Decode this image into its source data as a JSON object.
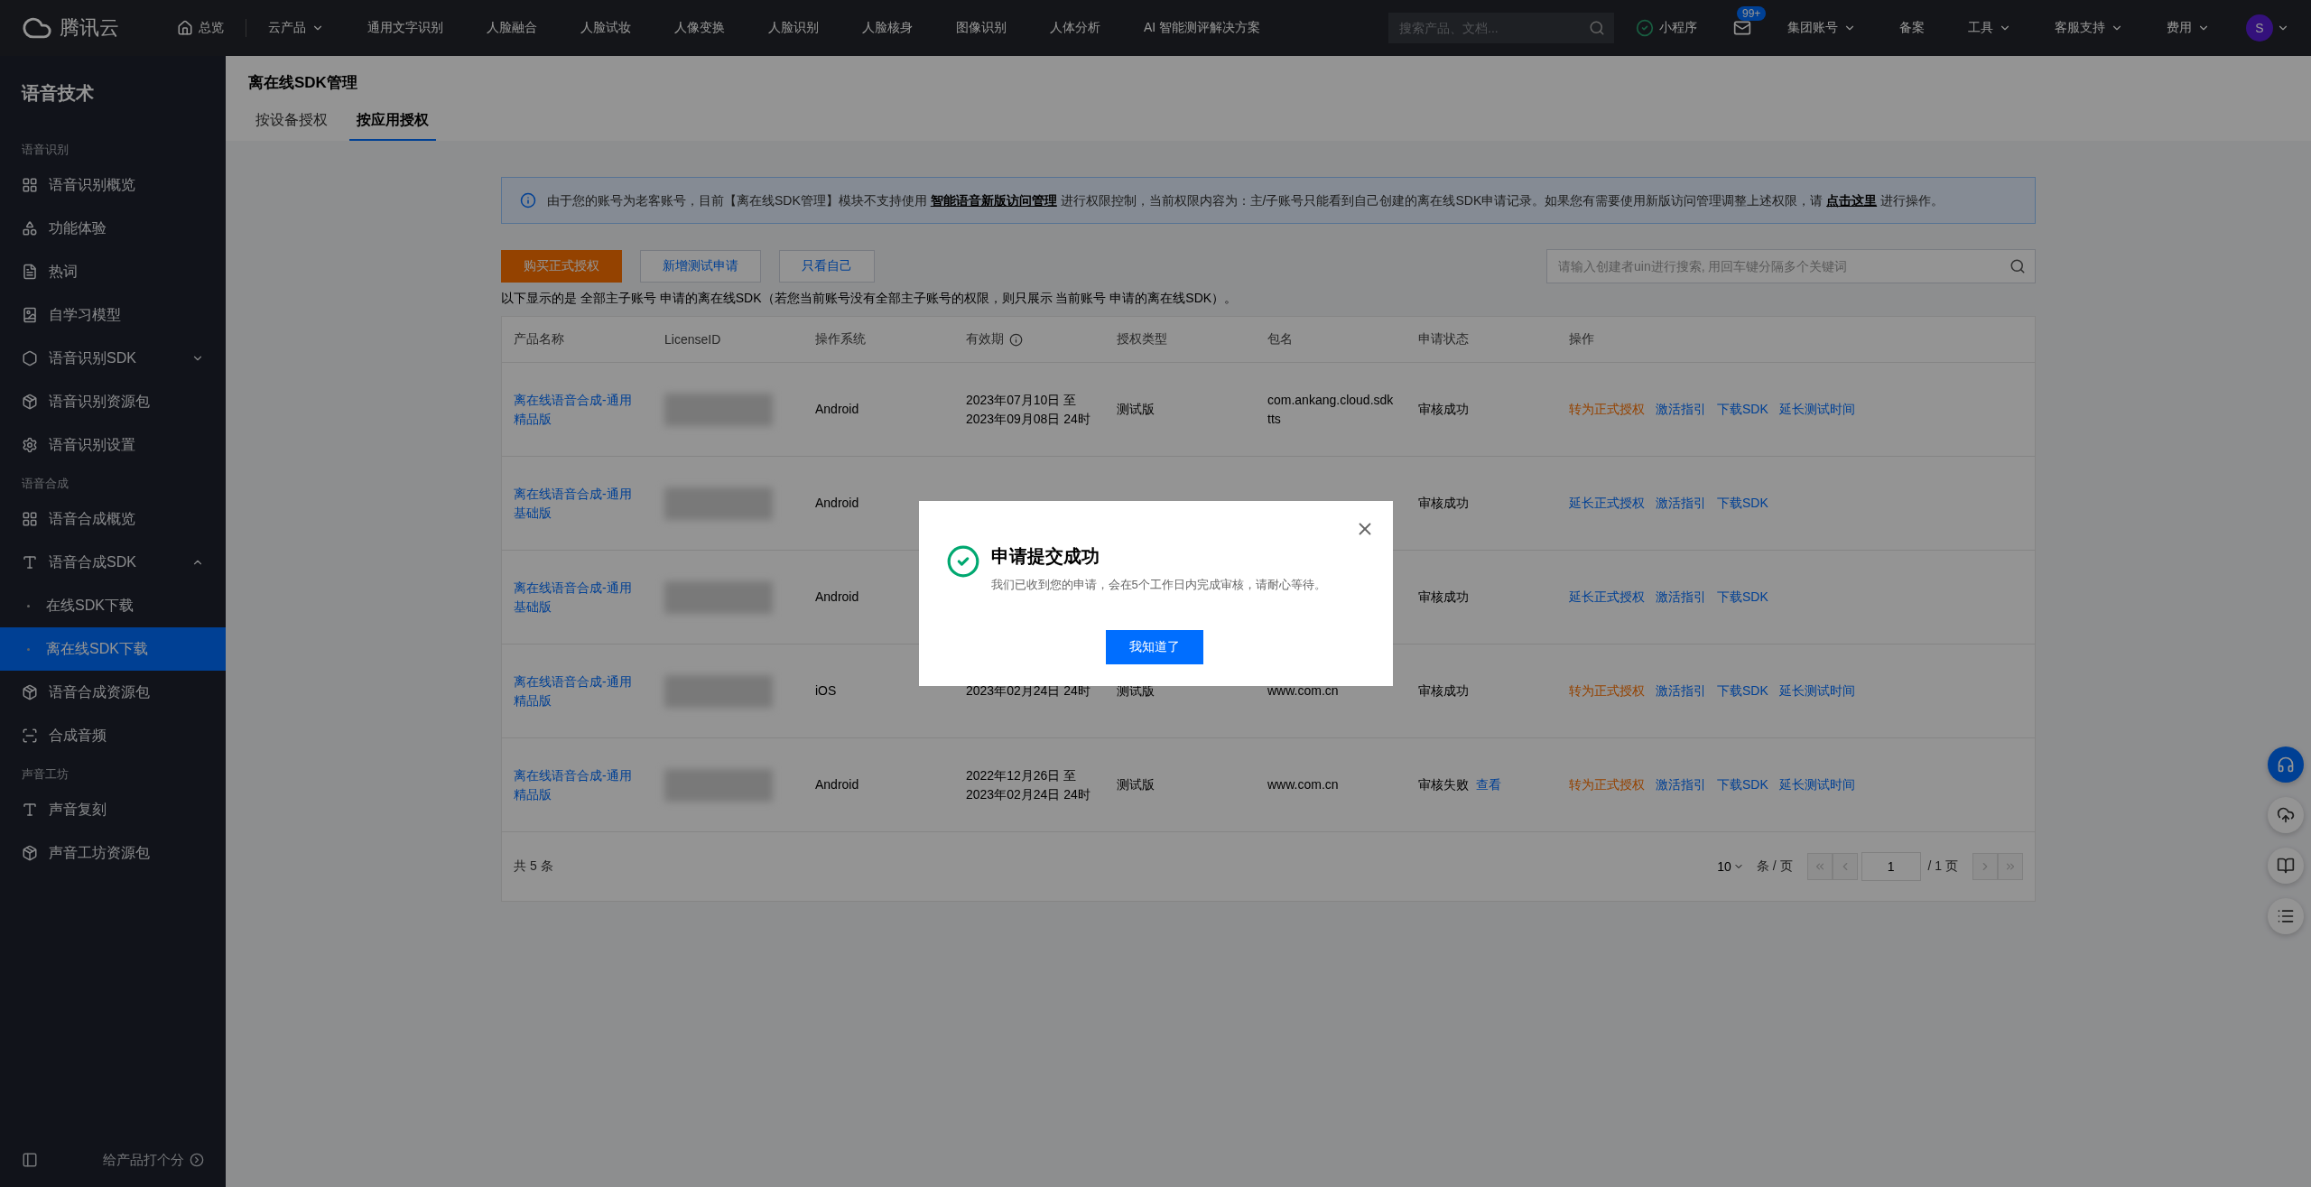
{
  "topbar": {
    "logo": "腾讯云",
    "home": "总览",
    "products": "云产品",
    "nav": [
      "通用文字识别",
      "人脸融合",
      "人脸试妆",
      "人像变换",
      "人脸识别",
      "人脸核身",
      "图像识别",
      "人体分析",
      "AI 智能测评解决方案"
    ],
    "search": {
      "placeholder": "搜索产品、文档..."
    },
    "miniapp": "小程序",
    "mail_badge": "99+",
    "menus": [
      {
        "label": "集团账号",
        "caret": true
      },
      {
        "label": "备案",
        "caret": false
      },
      {
        "label": "工具",
        "caret": true
      },
      {
        "label": "客服支持",
        "caret": true
      },
      {
        "label": "费用",
        "caret": true
      }
    ],
    "avatar": "S"
  },
  "sidebar": {
    "title": "语音技术",
    "groups": [
      {
        "label": "语音识别",
        "items": [
          {
            "label": "语音识别概览",
            "selected": false
          },
          {
            "label": "功能体验",
            "selected": false
          },
          {
            "label": "热词",
            "selected": false
          },
          {
            "label": "自学习模型",
            "selected": false
          },
          {
            "label": "语音识别SDK",
            "selected": false,
            "expanded": false
          },
          {
            "label": "语音识别资源包",
            "selected": false
          },
          {
            "label": "语音识别设置",
            "selected": false
          }
        ]
      },
      {
        "label": "语音合成",
        "items": [
          {
            "label": "语音合成概览",
            "selected": false
          },
          {
            "label": "语音合成SDK",
            "selected": false,
            "expanded": true,
            "children": [
              {
                "label": "在线SDK下载",
                "selected": false
              },
              {
                "label": "离在线SDK下载",
                "selected": true
              }
            ]
          },
          {
            "label": "语音合成资源包",
            "selected": false
          },
          {
            "label": "合成音频",
            "selected": false
          }
        ]
      },
      {
        "label": "声音工坊",
        "items": [
          {
            "label": "声音复刻",
            "selected": false
          },
          {
            "label": "声音工坊资源包",
            "selected": false
          }
        ]
      }
    ],
    "footer": "给产品打个分"
  },
  "page": {
    "title": "离在线SDK管理",
    "tabs": [
      {
        "label": "按设备授权",
        "selected": false
      },
      {
        "label": "按应用授权",
        "selected": true
      }
    ],
    "banner": [
      {
        "kind": "text",
        "text": "由于您的账号为老客账号，目前【离在线SDK管理】模块不支持使用 "
      },
      {
        "kind": "link",
        "text": "智能语音新版访问管理"
      },
      {
        "kind": "text",
        "text": " 进行权限控制，当前权限内容为：主/子账号只能看到自己创建的离在线SDK申请记录。如果您有需要使用新版访问管理调整上述权限，请 "
      },
      {
        "kind": "link",
        "text": "点击这里"
      },
      {
        "kind": "text",
        "text": " 进行操作。"
      }
    ],
    "buttons": [
      {
        "label": "购买正式授权",
        "kind": "primary"
      },
      {
        "label": "新增测试申请",
        "kind": "default"
      },
      {
        "label": "只看自己",
        "kind": "default"
      }
    ],
    "search": {
      "placeholder": "请输入创建者uin进行搜索, 用回车键分隔多个关键词"
    },
    "note": "以下显示的是 全部主子账号 申请的离在线SDK（若您当前账号没有全部主子账号的权限，则只展示 当前账号 申请的离在线SDK）。",
    "table": {
      "columns": [
        {
          "label": "产品名称",
          "info": false
        },
        {
          "label": "LicenseID",
          "info": false
        },
        {
          "label": "操作系统",
          "info": false
        },
        {
          "label": "有效期",
          "info": true
        },
        {
          "label": "授权类型",
          "info": false
        },
        {
          "label": "包名",
          "info": false
        },
        {
          "label": "申请状态",
          "info": false
        },
        {
          "label": "操作",
          "info": false
        }
      ],
      "rows": [
        {
          "product": "离在线语音合成-通用精品版",
          "license_redacted": true,
          "os": "Android",
          "validity": "2023年07月10日 至 2023年09月08日 24时",
          "type": "测试版",
          "package": "com.ankang.cloud.sdktts",
          "status": "审核成功",
          "actions": [
            {
              "label": "转为正式授权",
              "kind": "warn"
            },
            {
              "label": "激活指引",
              "kind": "link"
            },
            {
              "label": "下载SDK",
              "kind": "link"
            },
            {
              "label": "延长测试时间",
              "kind": "link"
            }
          ]
        },
        {
          "product": "离在线语音合成-通用基础版",
          "license_redacted": true,
          "os": "Android",
          "status": "审核成功",
          "actions": [
            {
              "label": "延长正式授权",
              "kind": "link"
            },
            {
              "label": "激活指引",
              "kind": "link"
            },
            {
              "label": "下载SDK",
              "kind": "link"
            }
          ]
        },
        {
          "product": "离在线语音合成-通用基础版",
          "license_redacted": true,
          "os": "Android",
          "status": "审核成功",
          "actions": [
            {
              "label": "延长正式授权",
              "kind": "link"
            },
            {
              "label": "激活指引",
              "kind": "link"
            },
            {
              "label": "下载SDK",
              "kind": "link"
            }
          ]
        },
        {
          "product": "离在线语音合成-通用精品版",
          "license_redacted": true,
          "os": "iOS",
          "validity": "2023年02月24日 24时",
          "type": "测试版",
          "package": "www.com.cn",
          "status": "审核成功",
          "actions": [
            {
              "label": "转为正式授权",
              "kind": "warn"
            },
            {
              "label": "激活指引",
              "kind": "link"
            },
            {
              "label": "下载SDK",
              "kind": "link"
            },
            {
              "label": "延长测试时间",
              "kind": "link"
            }
          ]
        },
        {
          "product": "离在线语音合成-通用精品版",
          "license_redacted": true,
          "os": "Android",
          "validity": "2022年12月26日 至 2023年02月24日 24时",
          "type": "测试版",
          "package": "www.com.cn",
          "status": "审核失败",
          "status_link": "查看",
          "actions": [
            {
              "label": "转为正式授权",
              "kind": "warn"
            },
            {
              "label": "激活指引",
              "kind": "link"
            },
            {
              "label": "下载SDK",
              "kind": "link"
            },
            {
              "label": "延长测试时间",
              "kind": "link"
            }
          ]
        }
      ]
    },
    "pagination": {
      "total": "共 5 条",
      "page_size": "10",
      "per_page": "条 / 页",
      "page": "1",
      "pages": "/ 1 页"
    }
  },
  "modal": {
    "title": "申请提交成功",
    "message": "我们已收到您的申请，会在5个工作日内完成审核，请耐心等待。",
    "button": "我知道了"
  }
}
